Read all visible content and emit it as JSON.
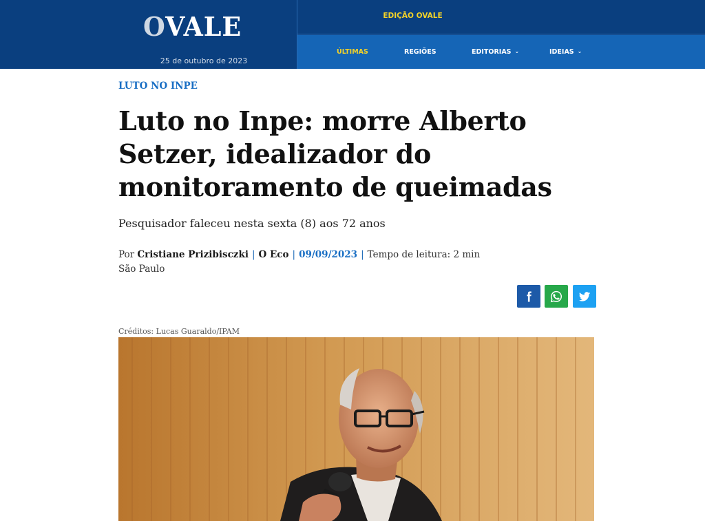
{
  "header": {
    "logo_text": "OVALE",
    "logo_text_o": "O",
    "logo_text_rest": "VALE",
    "date": "25 de outubro de 2023",
    "edition_label": "EDIÇÃO OVALE",
    "nav": [
      {
        "label": "ÚLTIMAS",
        "active": true,
        "has_dropdown": false
      },
      {
        "label": "REGIÕES",
        "active": false,
        "has_dropdown": false
      },
      {
        "label": "EDITORIAS",
        "active": false,
        "has_dropdown": true
      },
      {
        "label": "IDEIAS",
        "active": false,
        "has_dropdown": true
      }
    ]
  },
  "article": {
    "kicker": "LUTO NO INPE",
    "headline": "Luto no Inpe: morre Alberto Setzer, idealizador do monitoramento de queimadas",
    "subhead": "Pesquisador faleceu nesta sexta (8) aos 72 anos",
    "byline": {
      "prefix": "Por",
      "author": "Cristiane Prizibisczki",
      "outlet": "O Eco",
      "date": "09/09/2023",
      "reading_time": "Tempo de leitura: 2 min",
      "location": "São Paulo"
    },
    "share_buttons": [
      {
        "network": "facebook",
        "icon": "facebook-icon",
        "color": "#1d5aa8"
      },
      {
        "network": "whatsapp",
        "icon": "whatsapp-icon",
        "color": "#27a84a"
      },
      {
        "network": "twitter",
        "icon": "twitter-icon",
        "color": "#1da1f2"
      }
    ],
    "photo_credit": "Créditos: Lucas Guaraldo/IPAM"
  },
  "colors": {
    "header_dark": "#0a3f7f",
    "nav_blue": "#1565b6",
    "accent_yellow": "#f5d327",
    "link_blue": "#1a6fc4"
  }
}
